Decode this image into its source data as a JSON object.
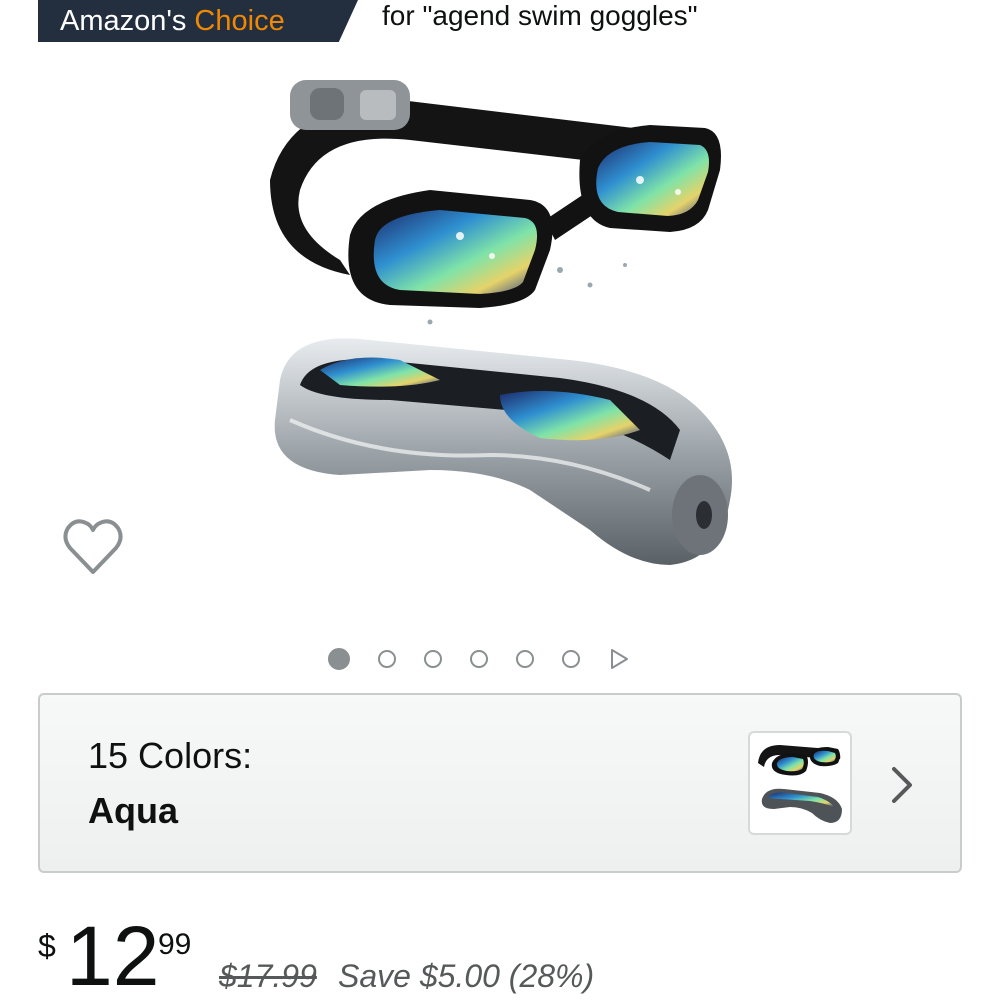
{
  "badge": {
    "amazons": "Amazon's",
    "choice": "Choice",
    "for_text": "for \"agend swim goggles\""
  },
  "product_image": {
    "icon": "swim-goggles-with-case-photo"
  },
  "wishlist": {
    "icon": "heart-icon"
  },
  "carousel": {
    "image_count": 6,
    "active_index": 0,
    "has_video": true
  },
  "variation": {
    "count_label": "15 Colors:",
    "selected": "Aqua",
    "icon": "chevron-right-icon"
  },
  "price": {
    "currency": "$",
    "whole": "12",
    "fraction": "99",
    "list_price": "$17.99",
    "savings": "Save $5.00 (28%)"
  },
  "colors": {
    "badge_bg": "#232f3e",
    "badge_choice": "#f08804",
    "dot": "#8a8f91"
  }
}
